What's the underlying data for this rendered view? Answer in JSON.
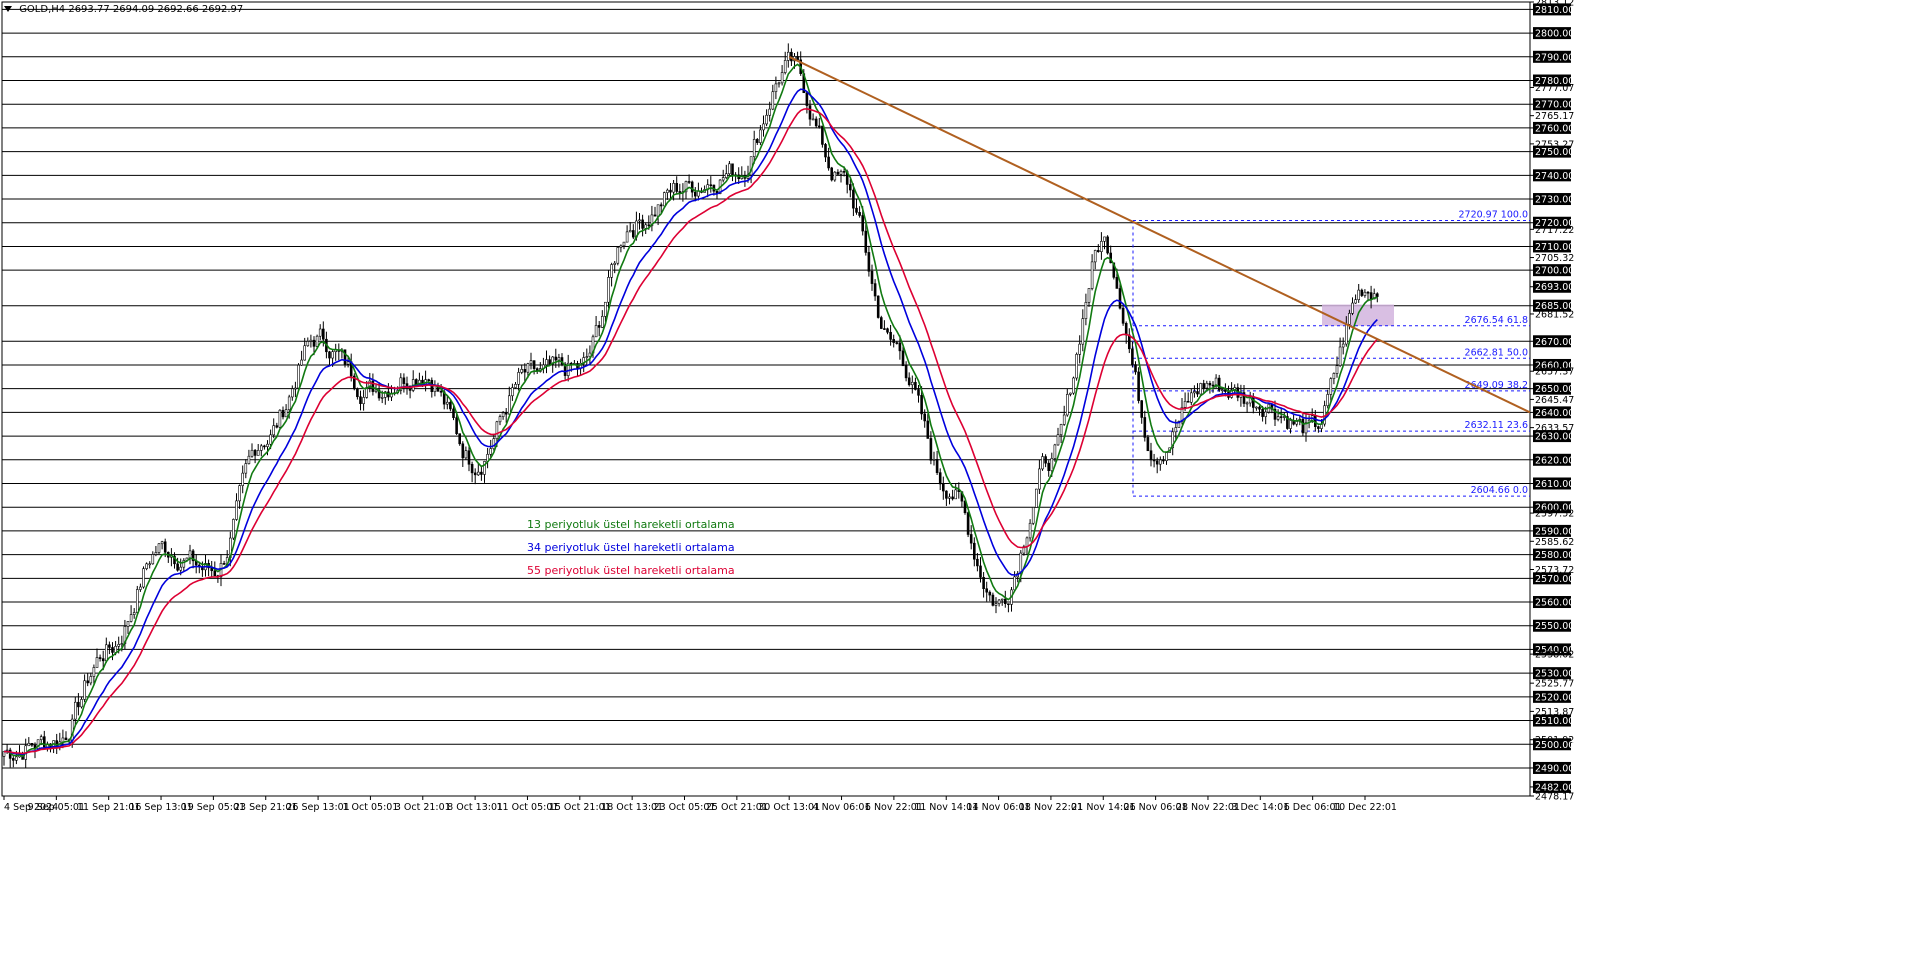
{
  "header": {
    "symbol": "GOLD,H4",
    "quote": "2693.77 2694.09 2692.66 2692.97"
  },
  "colors": {
    "ema13": "#117a11",
    "ema34": "#0000dd",
    "ema55": "#dd0033",
    "trendline": "#b06020",
    "fib": "#1a1aff",
    "zone": "#d2b4de",
    "grid": "#000000"
  },
  "legend": [
    {
      "text": "13 periyotluk üstel hareketli ortalama",
      "color": "#117a11"
    },
    {
      "text": "34 periyotluk üstel hareketli ortalama",
      "color": "#0000dd"
    },
    {
      "text": "55 periyotluk üstel hareketli ortalama",
      "color": "#dd0033"
    }
  ],
  "chart_data": {
    "type": "candlestick",
    "timeframe": "H4",
    "ylim": [
      2478.17,
      2813.12
    ],
    "price_ticks": [
      "2813.12",
      "2810.00",
      "2800.00",
      "2790.00",
      "2780.00",
      "2777.07",
      "2770.00",
      "2765.17",
      "2760.00",
      "2753.27",
      "2750.00",
      "2740.00",
      "2730.00",
      "2720.00",
      "2717.22",
      "2710.00",
      "2705.32",
      "2700.00",
      "2693.00",
      "2685.00",
      "2681.52",
      "2670.00",
      "2660.00",
      "2657.37",
      "2650.00",
      "2645.47",
      "2640.00",
      "2633.57",
      "2630.00",
      "2620.00",
      "2610.00",
      "2600.00",
      "2597.52",
      "2590.00",
      "2585.62",
      "2580.00",
      "2573.72",
      "2570.00",
      "2560.00",
      "2550.00",
      "2540.00",
      "2538.02",
      "2530.00",
      "2525.77",
      "2520.00",
      "2513.87",
      "2510.00",
      "2501.92",
      "2500.00",
      "2490.00",
      "2482.00",
      "2478.17"
    ],
    "boxed_price_ticks": [
      "2810.00",
      "2800.00",
      "2790.00",
      "2780.00",
      "2770.00",
      "2760.00",
      "2750.00",
      "2740.00",
      "2730.00",
      "2720.00",
      "2710.00",
      "2700.00",
      "2693.00",
      "2685.00",
      "2670.00",
      "2660.00",
      "2650.00",
      "2640.00",
      "2630.00",
      "2620.00",
      "2610.00",
      "2600.00",
      "2590.00",
      "2580.00",
      "2570.00",
      "2560.00",
      "2550.00",
      "2540.00",
      "2530.00",
      "2520.00",
      "2510.00",
      "2500.00",
      "2490.00",
      "2482.00"
    ],
    "horizontal_levels": [
      2810,
      2800,
      2790,
      2780,
      2770,
      2760,
      2750,
      2740,
      2730,
      2720,
      2710,
      2700,
      2685,
      2670,
      2660,
      2650,
      2640,
      2630,
      2620,
      2610,
      2600,
      2590,
      2580,
      2570,
      2560,
      2550,
      2540,
      2530,
      2520,
      2510,
      2500,
      2490
    ],
    "time_ticks": [
      "4 Sep 2024",
      "9 Sep 05:01",
      "11 Sep 21:01",
      "16 Sep 13:01",
      "19 Sep 05:01",
      "23 Sep 21:01",
      "26 Sep 13:01",
      "1 Oct 05:01",
      "3 Oct 21:01",
      "8 Oct 13:01",
      "11 Oct 05:01",
      "15 Oct 21:01",
      "18 Oct 13:01",
      "23 Oct 05:01",
      "25 Oct 21:01",
      "30 Oct 13:01",
      "4 Nov 06:01",
      "6 Nov 22:01",
      "11 Nov 14:01",
      "14 Nov 06:01",
      "18 Nov 22:01",
      "21 Nov 14:01",
      "26 Nov 06:01",
      "28 Nov 22:01",
      "3 Dec 14:01",
      "6 Dec 06:01",
      "10 Dec 22:01"
    ],
    "anchors": [
      {
        "t": "4 Sep 2024",
        "price": 2497
      },
      {
        "t": "9 Sep 05:01",
        "price": 2502
      },
      {
        "t": "11 Sep 21:01",
        "price": 2540
      },
      {
        "t": "16 Sep 13:01",
        "price": 2583
      },
      {
        "t": "19 Sep 05:01",
        "price": 2573
      },
      {
        "t": "23 Sep 21:01",
        "price": 2630
      },
      {
        "t": "26 Sep 13:01",
        "price": 2671
      },
      {
        "t": "1 Oct 05:01",
        "price": 2650
      },
      {
        "t": "3 Oct 21:01",
        "price": 2658
      },
      {
        "t": "8 Oct 13:01",
        "price": 2620
      },
      {
        "t": "11 Oct 05:01",
        "price": 2655
      },
      {
        "t": "15 Oct 21:01",
        "price": 2658
      },
      {
        "t": "18 Oct 13:01",
        "price": 2720
      },
      {
        "t": "23 Oct 05:01",
        "price": 2735
      },
      {
        "t": "25 Oct 21:01",
        "price": 2742
      },
      {
        "t": "30 Oct 13:01",
        "price": 2786
      },
      {
        "t": "4 Nov 06:01",
        "price": 2738
      },
      {
        "t": "6 Nov 22:01",
        "price": 2668
      },
      {
        "t": "11 Nov 14:01",
        "price": 2610
      },
      {
        "t": "14 Nov 06:01",
        "price": 2560
      },
      {
        "t": "18 Nov 22:01",
        "price": 2620
      },
      {
        "t": "21 Nov 14:01",
        "price": 2712
      },
      {
        "t": "26 Nov 06:01",
        "price": 2625
      },
      {
        "t": "28 Nov 22:01",
        "price": 2652
      },
      {
        "t": "3 Dec 14:01",
        "price": 2645
      },
      {
        "t": "6 Dec 06:01",
        "price": 2632
      },
      {
        "t": "10 Dec 22:01",
        "price": 2693
      }
    ],
    "fibonacci": [
      {
        "label": "2720.97 100.0",
        "price": 2720.97
      },
      {
        "label": "2676.54 61.8",
        "price": 2676.54
      },
      {
        "label": "2662.81 50.0",
        "price": 2662.81
      },
      {
        "label": "2649.09 38.2",
        "price": 2649.09
      },
      {
        "label": "2632.11 23.6",
        "price": 2632.11
      },
      {
        "label": "2604.66 0.0",
        "price": 2604.66
      }
    ],
    "trendline": {
      "from": {
        "t": "30 Oct 13:01",
        "price": 2790
      },
      "to_price_at_right_edge": 2640
    },
    "zone": {
      "low": 2676.5,
      "high": 2685.5
    },
    "series": [
      {
        "name": "13 periyotluk üstel hareketli ortalama",
        "period": 13
      },
      {
        "name": "34 periyotluk üstel hareketli ortalama",
        "period": 34
      },
      {
        "name": "55 periyotluk üstel hareketli ortalama",
        "period": 55
      }
    ],
    "grid": true
  }
}
